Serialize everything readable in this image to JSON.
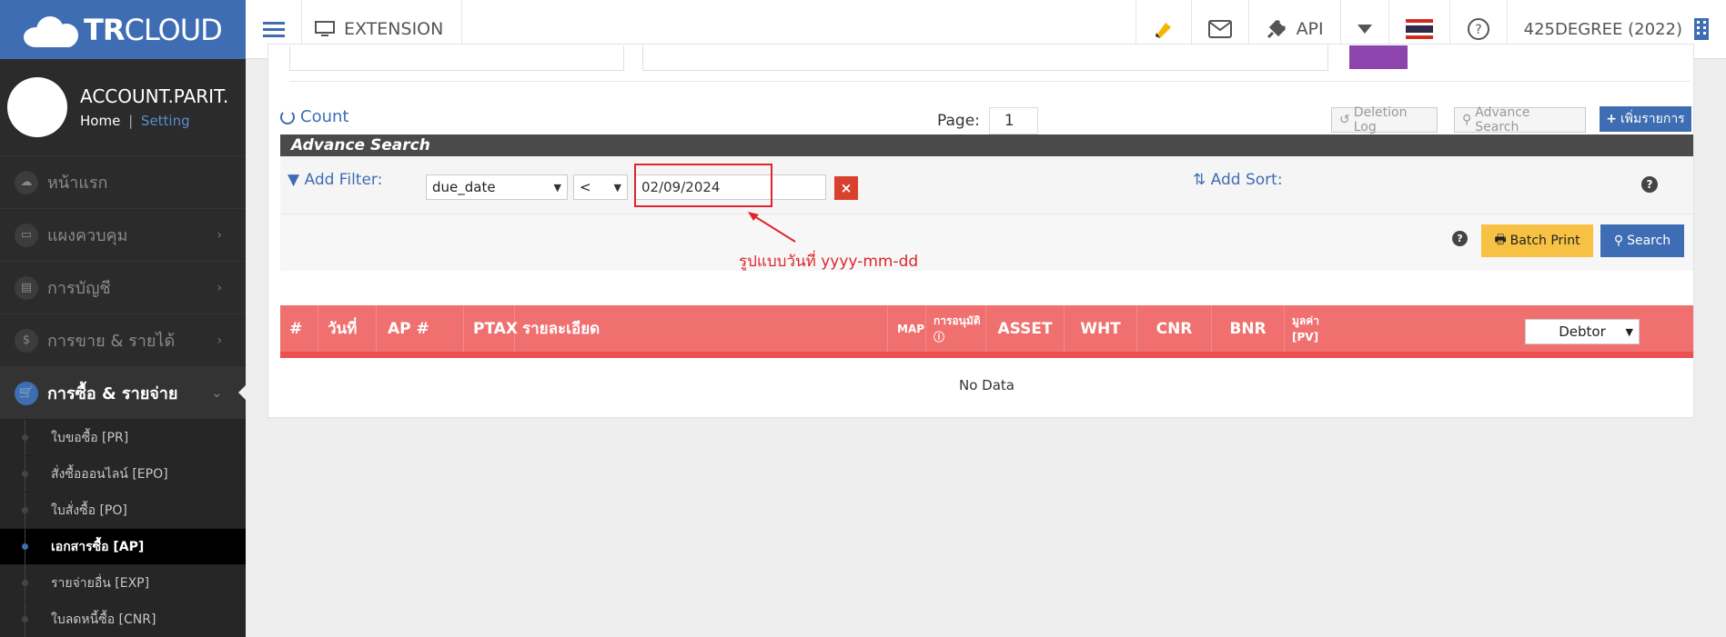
{
  "brand": {
    "logo_bold": "TR",
    "logo_rest": "CLOUD"
  },
  "topbar": {
    "extension_label": "EXTENSION",
    "api_label": "API",
    "account_label": "425DEGREE (2022)"
  },
  "sidebar": {
    "profile_name": "ACCOUNT.PARIT.",
    "home_link": "Home",
    "separator": "|",
    "setting_link": "Setting",
    "nav": [
      {
        "label": "หน้าแรก",
        "icon": "cloud-icon"
      },
      {
        "label": "แผงควบคุม",
        "icon": "monitor-icon"
      },
      {
        "label": "การบัญชี",
        "icon": "book-icon"
      },
      {
        "label": "การขาย & รายได้",
        "icon": "dollar-icon"
      },
      {
        "label": "การซื้อ & รายจ่าย",
        "icon": "cart-icon"
      }
    ],
    "sub": [
      {
        "label": "ใบขอซื้อ [PR]"
      },
      {
        "label": "สั่งซื้อออนไลน์ [EPO]"
      },
      {
        "label": "ใบสั่งซื้อ [PO]"
      },
      {
        "label": "เอกสารซื้อ [AP]"
      },
      {
        "label": "รายจ่ายอื่น [EXP]"
      },
      {
        "label": "ใบลดหนี้ซื้อ [CNR]"
      }
    ]
  },
  "toolbar": {
    "count_label": "Count",
    "page_label": "Page:",
    "page_value": "1",
    "deletion_log": "Deletion Log",
    "advance_search": "Advance Search",
    "add_item": "เพิ่มรายการ"
  },
  "advance": {
    "title": "Advance Search",
    "add_filter": "Add Filter:",
    "field": "due_date",
    "operator": "<",
    "date_value": "02/09/2024",
    "clear": "×",
    "add_sort": "Add Sort:",
    "help": "?",
    "batch_print": "Batch Print",
    "search": "Search"
  },
  "annotation": "รูปแบบวันที่ yyyy-mm-dd",
  "table": {
    "headers": [
      "#",
      "วันที่",
      "AP #",
      "PTAX",
      "รายละเอียด",
      "MAP",
      "การอนุมัติ",
      "ASSET",
      "WHT",
      "CNR",
      "BNR",
      "มูลค่า [PV]"
    ],
    "debtor": "Debtor",
    "empty": "No Data"
  },
  "colors": {
    "brand_blue": "#3f6db4",
    "table_header": "#f07070",
    "highlight_red": "#e0242b",
    "batch_yellow": "#f7c244"
  }
}
